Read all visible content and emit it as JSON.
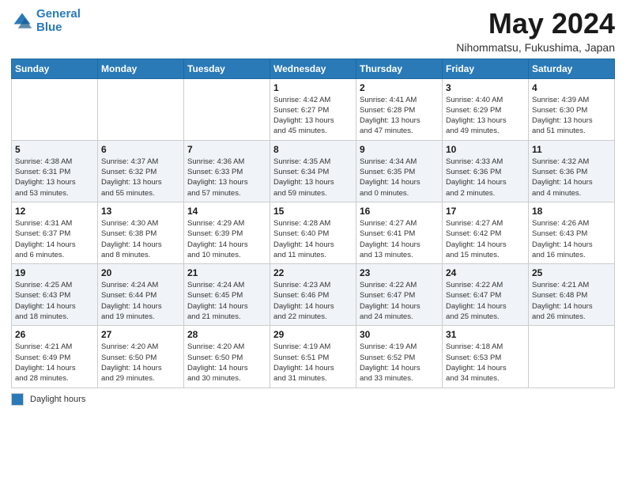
{
  "header": {
    "logo_line1": "General",
    "logo_line2": "Blue",
    "month_title": "May 2024",
    "location": "Nihommatsu, Fukushima, Japan"
  },
  "weekdays": [
    "Sunday",
    "Monday",
    "Tuesday",
    "Wednesday",
    "Thursday",
    "Friday",
    "Saturday"
  ],
  "legend": {
    "label": "Daylight hours"
  },
  "weeks": [
    [
      {
        "day": "",
        "info": ""
      },
      {
        "day": "",
        "info": ""
      },
      {
        "day": "",
        "info": ""
      },
      {
        "day": "1",
        "info": "Sunrise: 4:42 AM\nSunset: 6:27 PM\nDaylight: 13 hours\nand 45 minutes."
      },
      {
        "day": "2",
        "info": "Sunrise: 4:41 AM\nSunset: 6:28 PM\nDaylight: 13 hours\nand 47 minutes."
      },
      {
        "day": "3",
        "info": "Sunrise: 4:40 AM\nSunset: 6:29 PM\nDaylight: 13 hours\nand 49 minutes."
      },
      {
        "day": "4",
        "info": "Sunrise: 4:39 AM\nSunset: 6:30 PM\nDaylight: 13 hours\nand 51 minutes."
      }
    ],
    [
      {
        "day": "5",
        "info": "Sunrise: 4:38 AM\nSunset: 6:31 PM\nDaylight: 13 hours\nand 53 minutes."
      },
      {
        "day": "6",
        "info": "Sunrise: 4:37 AM\nSunset: 6:32 PM\nDaylight: 13 hours\nand 55 minutes."
      },
      {
        "day": "7",
        "info": "Sunrise: 4:36 AM\nSunset: 6:33 PM\nDaylight: 13 hours\nand 57 minutes."
      },
      {
        "day": "8",
        "info": "Sunrise: 4:35 AM\nSunset: 6:34 PM\nDaylight: 13 hours\nand 59 minutes."
      },
      {
        "day": "9",
        "info": "Sunrise: 4:34 AM\nSunset: 6:35 PM\nDaylight: 14 hours\nand 0 minutes."
      },
      {
        "day": "10",
        "info": "Sunrise: 4:33 AM\nSunset: 6:36 PM\nDaylight: 14 hours\nand 2 minutes."
      },
      {
        "day": "11",
        "info": "Sunrise: 4:32 AM\nSunset: 6:36 PM\nDaylight: 14 hours\nand 4 minutes."
      }
    ],
    [
      {
        "day": "12",
        "info": "Sunrise: 4:31 AM\nSunset: 6:37 PM\nDaylight: 14 hours\nand 6 minutes."
      },
      {
        "day": "13",
        "info": "Sunrise: 4:30 AM\nSunset: 6:38 PM\nDaylight: 14 hours\nand 8 minutes."
      },
      {
        "day": "14",
        "info": "Sunrise: 4:29 AM\nSunset: 6:39 PM\nDaylight: 14 hours\nand 10 minutes."
      },
      {
        "day": "15",
        "info": "Sunrise: 4:28 AM\nSunset: 6:40 PM\nDaylight: 14 hours\nand 11 minutes."
      },
      {
        "day": "16",
        "info": "Sunrise: 4:27 AM\nSunset: 6:41 PM\nDaylight: 14 hours\nand 13 minutes."
      },
      {
        "day": "17",
        "info": "Sunrise: 4:27 AM\nSunset: 6:42 PM\nDaylight: 14 hours\nand 15 minutes."
      },
      {
        "day": "18",
        "info": "Sunrise: 4:26 AM\nSunset: 6:43 PM\nDaylight: 14 hours\nand 16 minutes."
      }
    ],
    [
      {
        "day": "19",
        "info": "Sunrise: 4:25 AM\nSunset: 6:43 PM\nDaylight: 14 hours\nand 18 minutes."
      },
      {
        "day": "20",
        "info": "Sunrise: 4:24 AM\nSunset: 6:44 PM\nDaylight: 14 hours\nand 19 minutes."
      },
      {
        "day": "21",
        "info": "Sunrise: 4:24 AM\nSunset: 6:45 PM\nDaylight: 14 hours\nand 21 minutes."
      },
      {
        "day": "22",
        "info": "Sunrise: 4:23 AM\nSunset: 6:46 PM\nDaylight: 14 hours\nand 22 minutes."
      },
      {
        "day": "23",
        "info": "Sunrise: 4:22 AM\nSunset: 6:47 PM\nDaylight: 14 hours\nand 24 minutes."
      },
      {
        "day": "24",
        "info": "Sunrise: 4:22 AM\nSunset: 6:47 PM\nDaylight: 14 hours\nand 25 minutes."
      },
      {
        "day": "25",
        "info": "Sunrise: 4:21 AM\nSunset: 6:48 PM\nDaylight: 14 hours\nand 26 minutes."
      }
    ],
    [
      {
        "day": "26",
        "info": "Sunrise: 4:21 AM\nSunset: 6:49 PM\nDaylight: 14 hours\nand 28 minutes."
      },
      {
        "day": "27",
        "info": "Sunrise: 4:20 AM\nSunset: 6:50 PM\nDaylight: 14 hours\nand 29 minutes."
      },
      {
        "day": "28",
        "info": "Sunrise: 4:20 AM\nSunset: 6:50 PM\nDaylight: 14 hours\nand 30 minutes."
      },
      {
        "day": "29",
        "info": "Sunrise: 4:19 AM\nSunset: 6:51 PM\nDaylight: 14 hours\nand 31 minutes."
      },
      {
        "day": "30",
        "info": "Sunrise: 4:19 AM\nSunset: 6:52 PM\nDaylight: 14 hours\nand 33 minutes."
      },
      {
        "day": "31",
        "info": "Sunrise: 4:18 AM\nSunset: 6:53 PM\nDaylight: 14 hours\nand 34 minutes."
      },
      {
        "day": "",
        "info": ""
      }
    ]
  ]
}
